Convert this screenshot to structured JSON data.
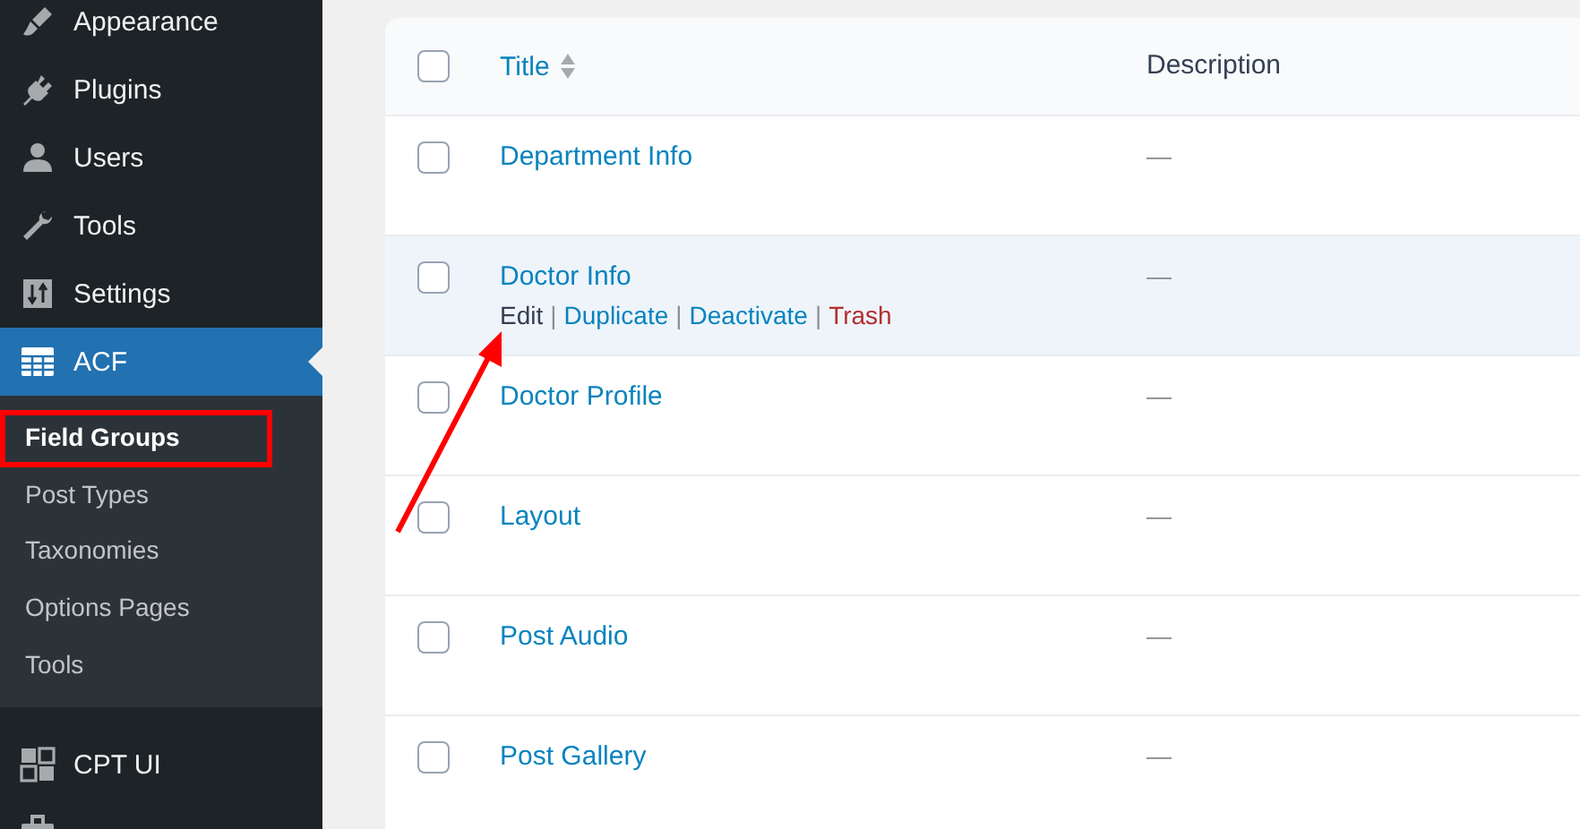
{
  "sidebar": {
    "items": [
      {
        "label": "Appearance",
        "selected": false
      },
      {
        "label": "Plugins",
        "selected": false
      },
      {
        "label": "Users",
        "selected": false
      },
      {
        "label": "Tools",
        "selected": false
      },
      {
        "label": "Settings",
        "selected": false
      },
      {
        "label": "ACF",
        "selected": true,
        "children": [
          {
            "label": "Field Groups",
            "selected": true,
            "highlighted": true
          },
          {
            "label": "Post Types",
            "selected": false,
            "highlighted": false
          },
          {
            "label": "Taxonomies",
            "selected": false,
            "highlighted": false
          },
          {
            "label": "Options Pages",
            "selected": false,
            "highlighted": false
          },
          {
            "label": "Tools",
            "selected": false,
            "highlighted": false
          }
        ]
      },
      {
        "label": "CPT UI",
        "selected": false
      },
      {
        "selected": false
      }
    ]
  },
  "table": {
    "columns": [
      {
        "label": "Title",
        "sortable": true
      },
      {
        "label": "Description",
        "sortable": false
      }
    ],
    "select_all_checked": false,
    "rows": [
      {
        "title": "Department Info",
        "description": "—",
        "checked": false,
        "hovered": false
      },
      {
        "title": "Doctor Info",
        "description": "—",
        "checked": false,
        "hovered": true,
        "actions": [
          {
            "label": "Edit",
            "kind": "edit"
          },
          {
            "label": "|",
            "kind": "separator"
          },
          {
            "label": "Duplicate",
            "kind": "link"
          },
          {
            "label": "|",
            "kind": "separator"
          },
          {
            "label": "Deactivate",
            "kind": "link"
          },
          {
            "label": "|",
            "kind": "separator"
          },
          {
            "label": "Trash",
            "kind": "danger"
          }
        ]
      },
      {
        "title": "Doctor Profile",
        "description": "—",
        "checked": false,
        "hovered": false
      },
      {
        "title": "Layout",
        "description": "—",
        "checked": false,
        "hovered": false
      },
      {
        "title": "Post Audio",
        "description": "—",
        "checked": false,
        "hovered": false
      },
      {
        "title": "Post Gallery",
        "description": "—",
        "checked": false,
        "hovered": false
      }
    ]
  }
}
